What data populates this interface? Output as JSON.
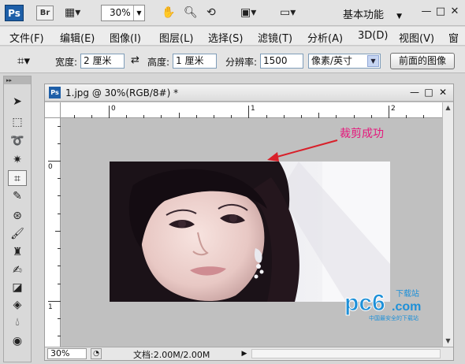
{
  "appbar": {
    "ps_logo": "Ps",
    "br_logo": "Br",
    "zoom_value": "30%",
    "workspace": "基本功能",
    "icons": [
      "bridge-icon",
      "camera-mode-icon",
      "hand-icon",
      "zoom-icon",
      "rotate-view-icon",
      "arrange-docs-icon",
      "screen-mode-icon"
    ]
  },
  "menubar": {
    "items": [
      "文件(F)",
      "编辑(E)",
      "图像(I)",
      "图层(L)",
      "选择(S)",
      "滤镜(T)",
      "分析(A)",
      "3D(D)",
      "视图(V)",
      "窗"
    ]
  },
  "options": {
    "width_label": "宽度:",
    "width_value": "2 厘米",
    "height_label": "高度:",
    "height_value": "1 厘米",
    "resolution_label": "分辨率:",
    "resolution_value": "1500",
    "resolution_unit": "像素/英寸",
    "front_image_button": "前面的图像"
  },
  "document": {
    "title": "1.jpg @ 30%(RGB/8#) *",
    "ps_icon": "Ps",
    "ruler_h_labels": [
      "0",
      "1",
      "2"
    ],
    "ruler_v_labels": [
      "0",
      "1"
    ],
    "annotation": "裁剪成功",
    "status_zoom": "30%",
    "status_doc": "文档:2.00M/2.00M"
  },
  "watermark": {
    "brand": "pc6",
    "tld": ".com",
    "tag": "下载站",
    "slogan": "中国最安全的下载站"
  },
  "colors": {
    "annotation": "#e5177b",
    "arrow": "#d8202a",
    "watermark": "#1e90d8",
    "ps_blue": "#1e5fa8"
  }
}
